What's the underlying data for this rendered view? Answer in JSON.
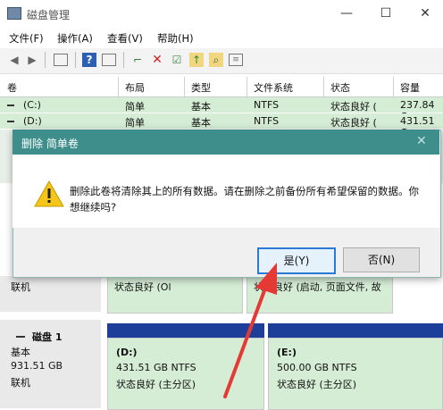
{
  "window": {
    "title": "磁盘管理",
    "minimize": "—",
    "maximize": "☐",
    "close": "✕"
  },
  "menu": [
    "文件(F)",
    "操作(A)",
    "查看(V)",
    "帮助(H)"
  ],
  "toolbar_icons": [
    "back-icon",
    "forward-icon",
    "properties-icon",
    "help-icon",
    "console-icon",
    "connect-icon",
    "delete-icon",
    "check-icon",
    "up-icon",
    "search-icon",
    "monitor-icon"
  ],
  "columns": [
    "卷",
    "布局",
    "类型",
    "文件系统",
    "状态",
    "容量"
  ],
  "volumes": [
    {
      "name": "(C:)",
      "layout": "简单",
      "type": "基本",
      "fs": "NTFS",
      "status": "状态良好 (",
      "capacity": "237.84 G"
    },
    {
      "name": "(D:)",
      "layout": "简单",
      "type": "基本",
      "fs": "NTFS",
      "status": "状态良好 (",
      "capacity": "431.51 G"
    }
  ],
  "partial_row": {
    "label": "联机",
    "c1": "状态良好 (Ol",
    "c2": "状态良好 (启动, 页面文件, 故"
  },
  "disk1": {
    "name": "磁盘 1",
    "type": "基本",
    "size": "931.51 GB",
    "state": "联机",
    "partitions": [
      {
        "label": "(D:)",
        "size": "431.51 GB NTFS",
        "status": "状态良好 (主分区)"
      },
      {
        "label": "(E:)",
        "size": "500.00 GB NTFS",
        "status": "状态良好 (主分区)"
      }
    ]
  },
  "dialog": {
    "title": "删除 简单卷",
    "close": "✕",
    "message": "删除此卷将清除其上的所有数据。请在删除之前备份所有希望保留的数据。你想继续吗?",
    "yes": "是(Y)",
    "no": "否(N)"
  },
  "colors": {
    "accent": "#3e8e8c",
    "volume_bg": "#d5ecd5",
    "partition_bar": "#1d3f9a",
    "arrow": "#e53935"
  }
}
